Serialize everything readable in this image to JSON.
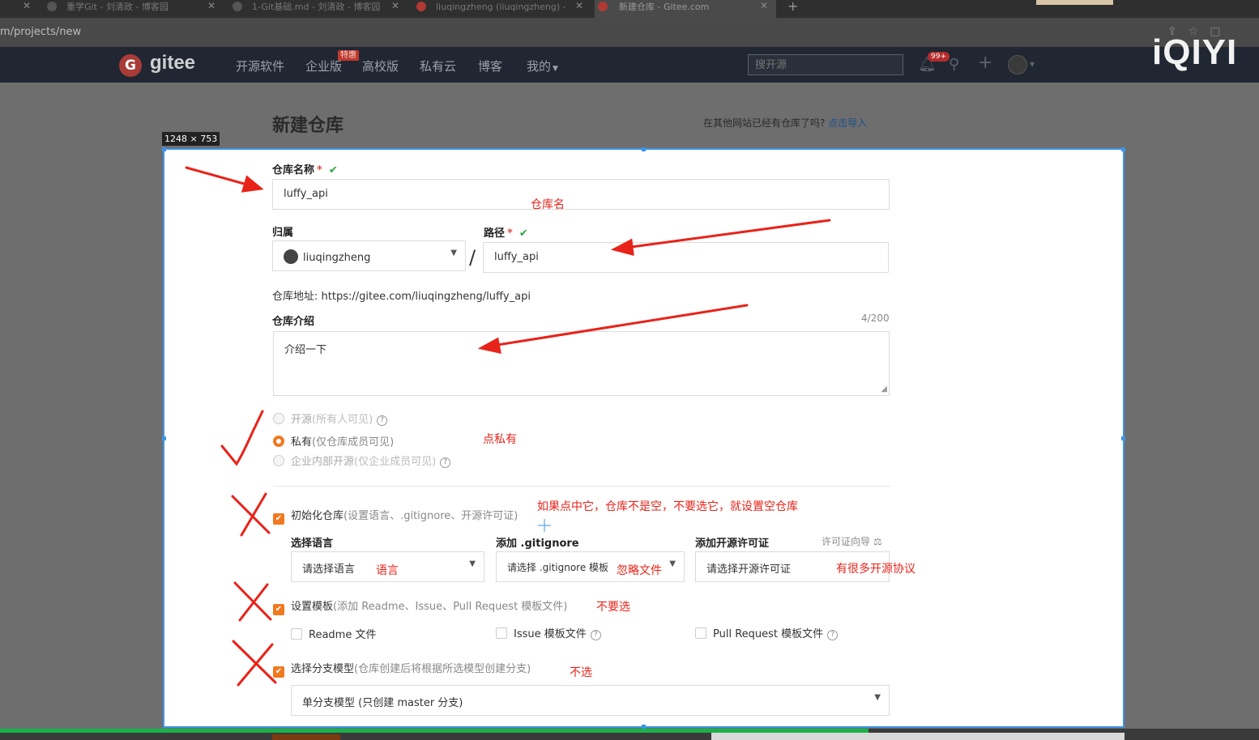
{
  "browser": {
    "tabs": [
      {
        "title": "重学Git - 刘清政 - 博客园"
      },
      {
        "title": "1-Git基础.md - 刘清政 - 博客园"
      },
      {
        "title": "liuqingzheng (liuqingzheng) -"
      },
      {
        "title": "新建仓库 - Gitee.com"
      }
    ],
    "url": "m/projects/new",
    "player_logo": "iQIYI"
  },
  "navbar": {
    "logo_mark": "G",
    "logo_text": "gitee",
    "items": [
      "开源软件",
      "企业版",
      "高校版",
      "私有云",
      "博客",
      "我的"
    ],
    "hot_badge": "特惠",
    "search_placeholder": "搜开源",
    "message_badge": "99+"
  },
  "page": {
    "title": "新建仓库",
    "import_hint": "在其他网站已经有仓库了吗?",
    "import_link": "点击导入",
    "dimension_label": "1248 × 753"
  },
  "form": {
    "repo_name_label": "仓库名称",
    "repo_name_value": "luffy_api",
    "owner_label": "归属",
    "owner_value": "liuqingzheng",
    "path_label": "路径",
    "path_value": "luffy_api",
    "repo_address_label": "仓库地址:",
    "repo_address_value": "https://gitee.com/liuqingzheng/luffy_api",
    "intro_label": "仓库介绍",
    "intro_counter": "4/200",
    "intro_value": "介绍一下",
    "visibility": [
      {
        "label": "开源",
        "sub": "(所有人可见)",
        "selected": false,
        "disabled": true
      },
      {
        "label": "私有",
        "sub": "(仅仓库成员可见)",
        "selected": true,
        "disabled": false
      },
      {
        "label": "企业内部开源",
        "sub": "(仅企业成员可见)",
        "selected": false,
        "disabled": true
      }
    ],
    "init_repo": {
      "label": "初始化仓库",
      "sub": "(设置语言、.gitignore、开源许可证)",
      "checked": true
    },
    "language_label": "选择语言",
    "language_placeholder": "请选择语言",
    "gitignore_label": "添加 .gitignore",
    "gitignore_placeholder": "请选择 .gitignore 模板",
    "license_label": "添加开源许可证",
    "license_guide": "许可证向导",
    "license_placeholder": "请选择开源许可证",
    "template": {
      "label": "设置模板",
      "sub": "(添加 Readme、Issue、Pull Request 模板文件)",
      "checked": true
    },
    "readme_label": "Readme 文件",
    "issue_label": "Issue 模板文件",
    "pr_label": "Pull Request 模板文件",
    "branch": {
      "label": "选择分支模型",
      "sub": "(仓库创建后将根据所选模型创建分支)",
      "checked": true
    },
    "branch_model_value": "单分支模型 (只创建 master 分支)"
  },
  "annotations": {
    "repo_name": "仓库名",
    "private": "点私有",
    "init_warning": "如果点中它，仓库不是空，不要选它，就设置空仓库",
    "language": "语言",
    "gitignore": "忽略文件",
    "license": "有很多开源协议",
    "template": "不要选",
    "branch": "不选"
  },
  "video_progress": 0.69,
  "colors": {
    "accent": "#f0791f",
    "selection": "#3d93e8",
    "annotation": "#e8231a",
    "navbar": "#202733"
  }
}
